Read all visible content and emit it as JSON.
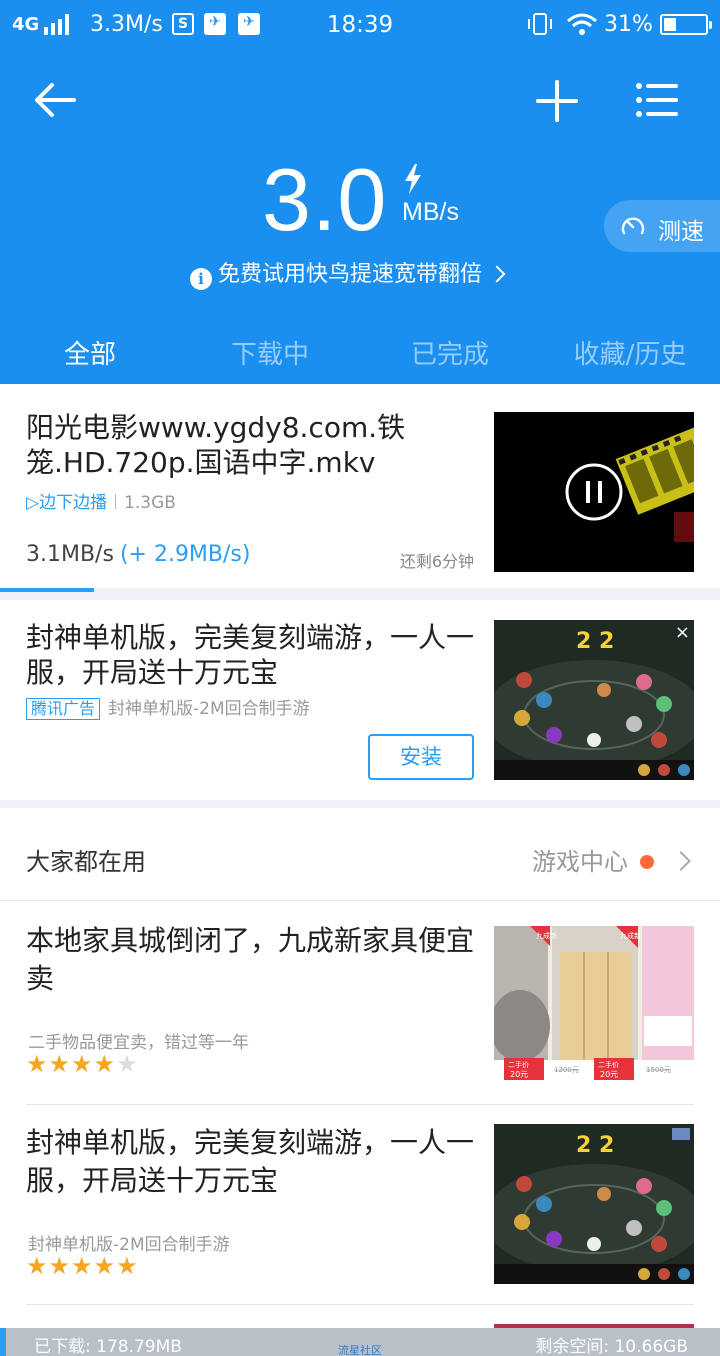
{
  "status_bar": {
    "network": "4G",
    "speed": "3.3M/s",
    "time": "18:39",
    "battery_pct": "31%",
    "battery_level": 0.31
  },
  "header": {
    "speed_value": "3.0",
    "speed_unit": "MB/s",
    "speed_test_label": "测速",
    "promo_text": "免费试用快鸟提速宽带翻倍"
  },
  "tabs": [
    {
      "label": "全部",
      "active": true
    },
    {
      "label": "下载中",
      "active": false
    },
    {
      "label": "已完成",
      "active": false
    },
    {
      "label": "收藏/历史",
      "active": false
    }
  ],
  "download": {
    "title": "阳光电影www.ygdy8.com.铁笼.HD.720p.国语中字.mkv",
    "play_label": "▷边下边播",
    "size": "1.3GB",
    "speed": "3.1MB/s",
    "boost": "(+ 2.9MB/s)",
    "remaining": "还剩6分钟",
    "progress": 0.13
  },
  "ad": {
    "title": "封神单机版，完美复刻端游，一人一服，开局送十万元宝",
    "tag": "腾讯广告",
    "subtitle": "封神单机版-2M回合制手游",
    "install_label": "安装",
    "close_symbol": "×"
  },
  "recommend": {
    "heading": "大家都在用",
    "more_label": "游戏中心",
    "items": [
      {
        "title": "本地家具城倒闭了，九成新家具便宜卖",
        "subtitle": "二手物品便宜卖，错过等一年",
        "rating": 4,
        "thumb_texts": [
          "九成新",
          "九成新",
          "二手价",
          "20元",
          "1200元",
          "二手价",
          "20元",
          "1500元"
        ]
      },
      {
        "title": "封神单机版，完美复刻端游，一人一服，开局送十万元宝",
        "subtitle": "封神单机版-2M回合制手游",
        "rating": 5
      }
    ]
  },
  "bottom_bar": {
    "downloaded": "已下载: 178.79MB",
    "center_text": "流星社区",
    "free_space": "剩余空间: 10.66GB"
  },
  "colors": {
    "brand_blue": "#1b8ff0",
    "link_blue": "#2a9df4",
    "star_orange": "#f5a623",
    "dot_orange": "#ff6a3d"
  }
}
